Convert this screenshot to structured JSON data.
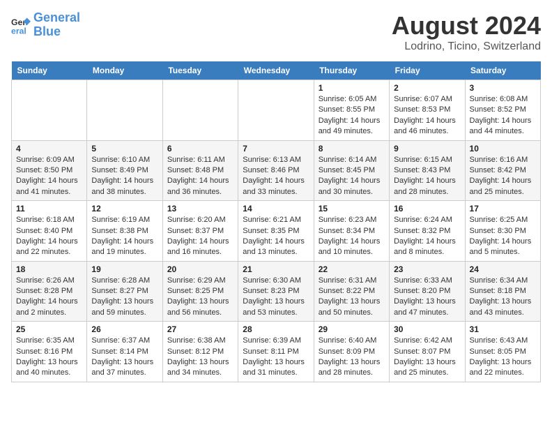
{
  "header": {
    "logo_line1": "General",
    "logo_line2": "Blue",
    "month_year": "August 2024",
    "location": "Lodrino, Ticino, Switzerland"
  },
  "weekdays": [
    "Sunday",
    "Monday",
    "Tuesday",
    "Wednesday",
    "Thursday",
    "Friday",
    "Saturday"
  ],
  "weeks": [
    [
      {
        "day": "",
        "sunrise": "",
        "sunset": "",
        "daylight": ""
      },
      {
        "day": "",
        "sunrise": "",
        "sunset": "",
        "daylight": ""
      },
      {
        "day": "",
        "sunrise": "",
        "sunset": "",
        "daylight": ""
      },
      {
        "day": "",
        "sunrise": "",
        "sunset": "",
        "daylight": ""
      },
      {
        "day": "1",
        "sunrise": "Sunrise: 6:05 AM",
        "sunset": "Sunset: 8:55 PM",
        "daylight": "Daylight: 14 hours and 49 minutes."
      },
      {
        "day": "2",
        "sunrise": "Sunrise: 6:07 AM",
        "sunset": "Sunset: 8:53 PM",
        "daylight": "Daylight: 14 hours and 46 minutes."
      },
      {
        "day": "3",
        "sunrise": "Sunrise: 6:08 AM",
        "sunset": "Sunset: 8:52 PM",
        "daylight": "Daylight: 14 hours and 44 minutes."
      }
    ],
    [
      {
        "day": "4",
        "sunrise": "Sunrise: 6:09 AM",
        "sunset": "Sunset: 8:50 PM",
        "daylight": "Daylight: 14 hours and 41 minutes."
      },
      {
        "day": "5",
        "sunrise": "Sunrise: 6:10 AM",
        "sunset": "Sunset: 8:49 PM",
        "daylight": "Daylight: 14 hours and 38 minutes."
      },
      {
        "day": "6",
        "sunrise": "Sunrise: 6:11 AM",
        "sunset": "Sunset: 8:48 PM",
        "daylight": "Daylight: 14 hours and 36 minutes."
      },
      {
        "day": "7",
        "sunrise": "Sunrise: 6:13 AM",
        "sunset": "Sunset: 8:46 PM",
        "daylight": "Daylight: 14 hours and 33 minutes."
      },
      {
        "day": "8",
        "sunrise": "Sunrise: 6:14 AM",
        "sunset": "Sunset: 8:45 PM",
        "daylight": "Daylight: 14 hours and 30 minutes."
      },
      {
        "day": "9",
        "sunrise": "Sunrise: 6:15 AM",
        "sunset": "Sunset: 8:43 PM",
        "daylight": "Daylight: 14 hours and 28 minutes."
      },
      {
        "day": "10",
        "sunrise": "Sunrise: 6:16 AM",
        "sunset": "Sunset: 8:42 PM",
        "daylight": "Daylight: 14 hours and 25 minutes."
      }
    ],
    [
      {
        "day": "11",
        "sunrise": "Sunrise: 6:18 AM",
        "sunset": "Sunset: 8:40 PM",
        "daylight": "Daylight: 14 hours and 22 minutes."
      },
      {
        "day": "12",
        "sunrise": "Sunrise: 6:19 AM",
        "sunset": "Sunset: 8:38 PM",
        "daylight": "Daylight: 14 hours and 19 minutes."
      },
      {
        "day": "13",
        "sunrise": "Sunrise: 6:20 AM",
        "sunset": "Sunset: 8:37 PM",
        "daylight": "Daylight: 14 hours and 16 minutes."
      },
      {
        "day": "14",
        "sunrise": "Sunrise: 6:21 AM",
        "sunset": "Sunset: 8:35 PM",
        "daylight": "Daylight: 14 hours and 13 minutes."
      },
      {
        "day": "15",
        "sunrise": "Sunrise: 6:23 AM",
        "sunset": "Sunset: 8:34 PM",
        "daylight": "Daylight: 14 hours and 10 minutes."
      },
      {
        "day": "16",
        "sunrise": "Sunrise: 6:24 AM",
        "sunset": "Sunset: 8:32 PM",
        "daylight": "Daylight: 14 hours and 8 minutes."
      },
      {
        "day": "17",
        "sunrise": "Sunrise: 6:25 AM",
        "sunset": "Sunset: 8:30 PM",
        "daylight": "Daylight: 14 hours and 5 minutes."
      }
    ],
    [
      {
        "day": "18",
        "sunrise": "Sunrise: 6:26 AM",
        "sunset": "Sunset: 8:28 PM",
        "daylight": "Daylight: 14 hours and 2 minutes."
      },
      {
        "day": "19",
        "sunrise": "Sunrise: 6:28 AM",
        "sunset": "Sunset: 8:27 PM",
        "daylight": "Daylight: 13 hours and 59 minutes."
      },
      {
        "day": "20",
        "sunrise": "Sunrise: 6:29 AM",
        "sunset": "Sunset: 8:25 PM",
        "daylight": "Daylight: 13 hours and 56 minutes."
      },
      {
        "day": "21",
        "sunrise": "Sunrise: 6:30 AM",
        "sunset": "Sunset: 8:23 PM",
        "daylight": "Daylight: 13 hours and 53 minutes."
      },
      {
        "day": "22",
        "sunrise": "Sunrise: 6:31 AM",
        "sunset": "Sunset: 8:22 PM",
        "daylight": "Daylight: 13 hours and 50 minutes."
      },
      {
        "day": "23",
        "sunrise": "Sunrise: 6:33 AM",
        "sunset": "Sunset: 8:20 PM",
        "daylight": "Daylight: 13 hours and 47 minutes."
      },
      {
        "day": "24",
        "sunrise": "Sunrise: 6:34 AM",
        "sunset": "Sunset: 8:18 PM",
        "daylight": "Daylight: 13 hours and 43 minutes."
      }
    ],
    [
      {
        "day": "25",
        "sunrise": "Sunrise: 6:35 AM",
        "sunset": "Sunset: 8:16 PM",
        "daylight": "Daylight: 13 hours and 40 minutes."
      },
      {
        "day": "26",
        "sunrise": "Sunrise: 6:37 AM",
        "sunset": "Sunset: 8:14 PM",
        "daylight": "Daylight: 13 hours and 37 minutes."
      },
      {
        "day": "27",
        "sunrise": "Sunrise: 6:38 AM",
        "sunset": "Sunset: 8:12 PM",
        "daylight": "Daylight: 13 hours and 34 minutes."
      },
      {
        "day": "28",
        "sunrise": "Sunrise: 6:39 AM",
        "sunset": "Sunset: 8:11 PM",
        "daylight": "Daylight: 13 hours and 31 minutes."
      },
      {
        "day": "29",
        "sunrise": "Sunrise: 6:40 AM",
        "sunset": "Sunset: 8:09 PM",
        "daylight": "Daylight: 13 hours and 28 minutes."
      },
      {
        "day": "30",
        "sunrise": "Sunrise: 6:42 AM",
        "sunset": "Sunset: 8:07 PM",
        "daylight": "Daylight: 13 hours and 25 minutes."
      },
      {
        "day": "31",
        "sunrise": "Sunrise: 6:43 AM",
        "sunset": "Sunset: 8:05 PM",
        "daylight": "Daylight: 13 hours and 22 minutes."
      }
    ]
  ]
}
